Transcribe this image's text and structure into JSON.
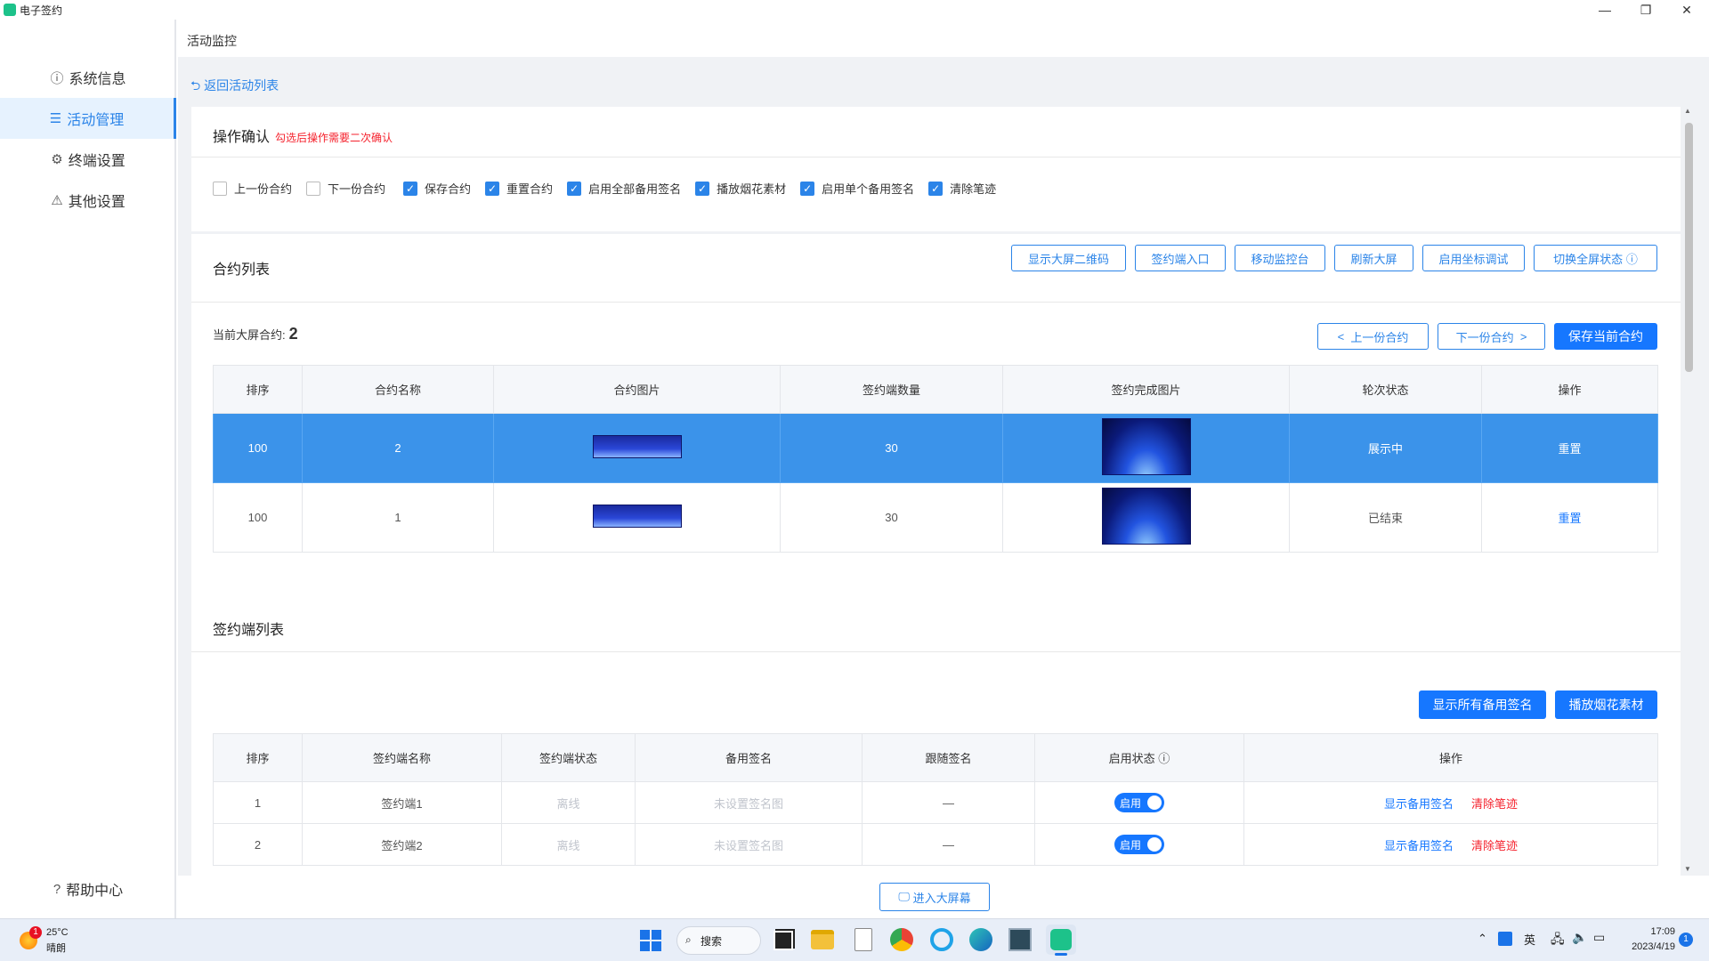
{
  "app": {
    "title": "电子签约"
  },
  "sidebar": {
    "items": [
      {
        "label": "系统信息",
        "icon": "info-icon"
      },
      {
        "label": "活动管理",
        "icon": "list-icon",
        "active": true
      },
      {
        "label": "终端设置",
        "icon": "gear-icon"
      },
      {
        "label": "其他设置",
        "icon": "warning-icon"
      }
    ],
    "help": {
      "label": "帮助中心",
      "icon": "help-icon"
    }
  },
  "breadcrumb": "活动监控",
  "back_link": "返回活动列表",
  "confirm": {
    "title": "操作确认",
    "hint": "勾选后操作需要二次确认",
    "options": [
      {
        "label": "上一份合约",
        "checked": false
      },
      {
        "label": "下一份合约",
        "checked": false
      },
      {
        "label": "保存合约",
        "checked": true
      },
      {
        "label": "重置合约",
        "checked": true
      },
      {
        "label": "启用全部备用签名",
        "checked": true
      },
      {
        "label": "播放烟花素材",
        "checked": true
      },
      {
        "label": "启用单个备用签名",
        "checked": true
      },
      {
        "label": "清除笔迹",
        "checked": true
      }
    ]
  },
  "contracts": {
    "title": "合约列表",
    "actions": [
      "显示大屏二维码",
      "签约端入口",
      "移动监控台",
      "刷新大屏",
      "启用坐标调试",
      "切换全屏状态"
    ],
    "current_label": "当前大屏合约:",
    "current_value": "2",
    "prev": "上一份合约",
    "next": "下一份合约",
    "save": "保存当前合约",
    "columns": [
      "排序",
      "合约名称",
      "合约图片",
      "签约端数量",
      "签约完成图片",
      "轮次状态",
      "操作"
    ],
    "rows": [
      {
        "order": "100",
        "name": "2",
        "count": "30",
        "status": "展示中",
        "action": "重置",
        "selected": true
      },
      {
        "order": "100",
        "name": "1",
        "count": "30",
        "status": "已结束",
        "action": "重置",
        "selected": false
      }
    ]
  },
  "terminals": {
    "title": "签约端列表",
    "show_all": "显示所有备用签名",
    "fireworks": "播放烟花素材",
    "columns": [
      "排序",
      "签约端名称",
      "签约端状态",
      "备用签名",
      "跟随签名",
      "启用状态",
      "操作"
    ],
    "rows": [
      {
        "order": "1",
        "name": "签约端1",
        "state": "离线",
        "backup": "未设置签名图",
        "follow": "—",
        "toggle": "启用",
        "action1": "显示备用签名",
        "action2": "清除笔迹"
      },
      {
        "order": "2",
        "name": "签约端2",
        "state": "离线",
        "backup": "未设置签名图",
        "follow": "—",
        "toggle": "启用",
        "action1": "显示备用签名",
        "action2": "清除笔迹"
      }
    ]
  },
  "enter_big_screen": "进入大屏幕",
  "taskbar": {
    "weather_temp": "25°C",
    "weather_desc": "晴朗",
    "weather_badge": "1",
    "search": "搜索",
    "ime": "英",
    "time": "17:09",
    "date": "2023/4/19",
    "notif": "1"
  }
}
